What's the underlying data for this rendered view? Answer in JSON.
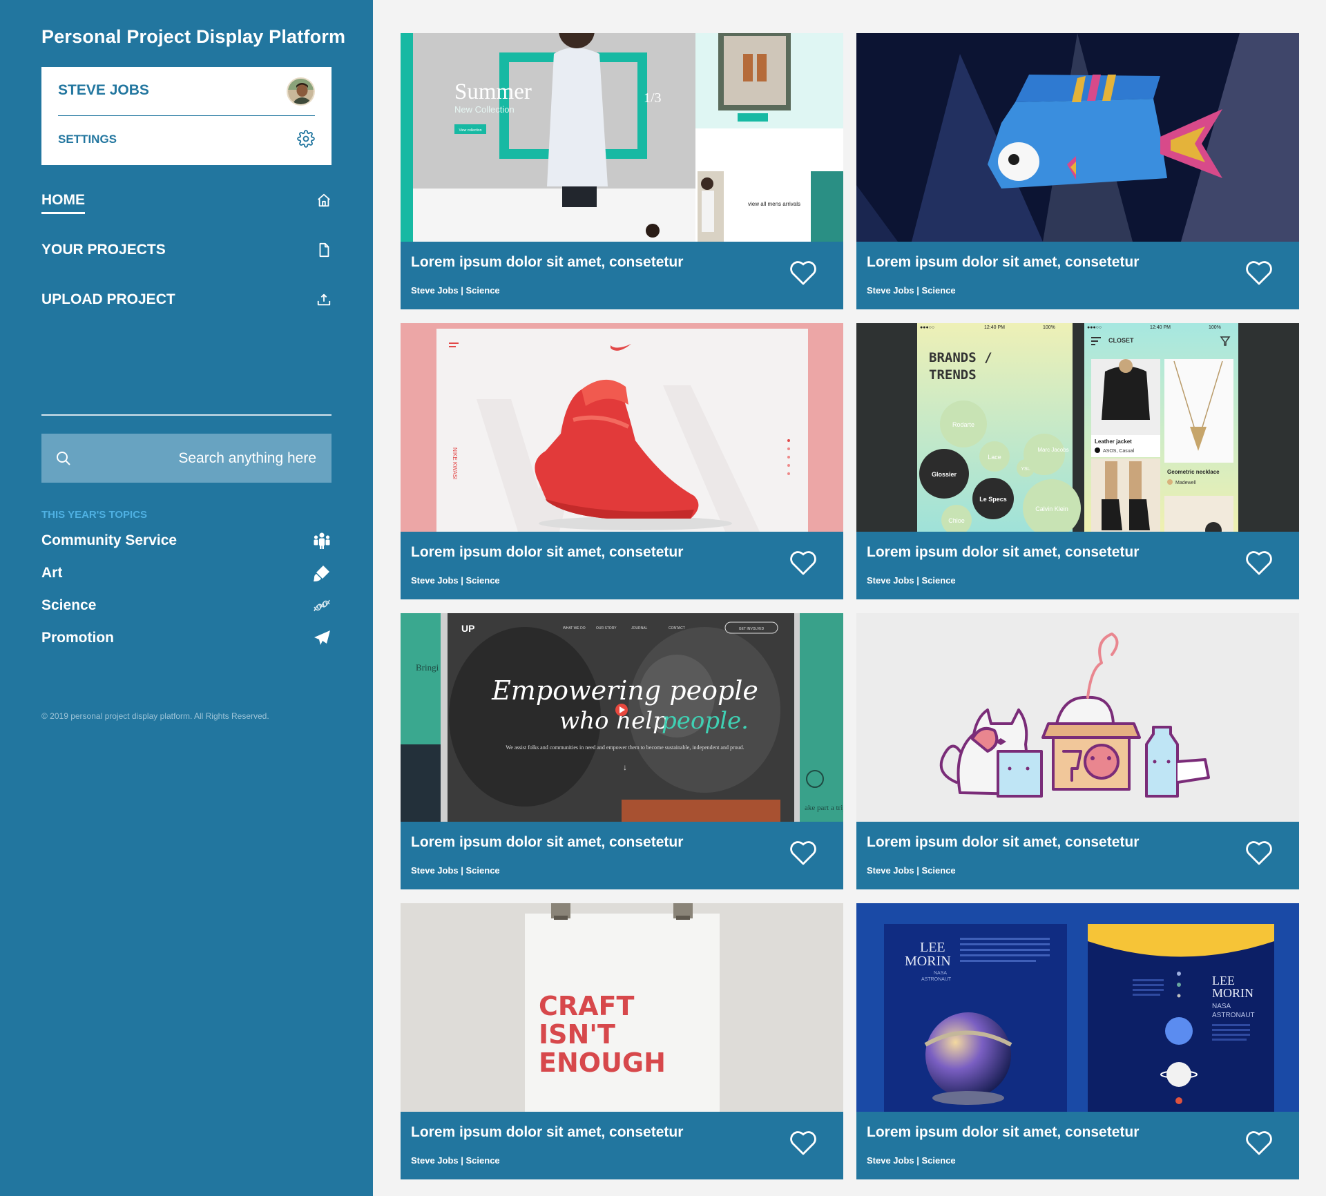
{
  "app": {
    "title": "Personal Project Display Platform"
  },
  "profile": {
    "name": "STEVE JOBS",
    "settings_label": "SETTINGS"
  },
  "nav": [
    {
      "label": "HOME",
      "icon": "home-icon",
      "active": true
    },
    {
      "label": "YOUR PROJECTS",
      "icon": "document-icon"
    },
    {
      "label": "UPLOAD PROJECT",
      "icon": "upload-icon"
    }
  ],
  "search": {
    "placeholder": "Search anything here"
  },
  "topics": {
    "heading": "THIS YEAR'S TOPICS",
    "items": [
      {
        "label": "Community Service",
        "icon": "people-icon"
      },
      {
        "label": "Art",
        "icon": "paint-brush-icon"
      },
      {
        "label": "Science",
        "icon": "dna-icon"
      },
      {
        "label": "Promotion",
        "icon": "paper-plane-icon"
      }
    ]
  },
  "footer": {
    "copyright": "© 2019 personal project display platform. All Rights Reserved."
  },
  "projects": [
    {
      "title": "Lorem ipsum dolor sit amet, consetetur",
      "author": "Steve Jobs",
      "category": "Science",
      "meta": "Steve Jobs | Science",
      "thumbnail": {
        "headline": "Summer",
        "subline": "New Collection",
        "button": "View collection",
        "counter": "1/3",
        "link": "view all mens arrivals"
      }
    },
    {
      "title": "Lorem ipsum dolor sit amet, consetetur",
      "author": "Steve Jobs",
      "category": "Science",
      "meta": "Steve Jobs | Science",
      "thumbnail": {}
    },
    {
      "title": "Lorem ipsum dolor sit amet, consetetur",
      "author": "Steve Jobs",
      "category": "Science",
      "meta": "Steve Jobs | Science",
      "thumbnail": {
        "side_text": "NIKE KWASI"
      }
    },
    {
      "title": "Lorem ipsum dolor sit amet, consetetur",
      "author": "Steve Jobs",
      "category": "Science",
      "meta": "Steve Jobs | Science",
      "thumbnail": {
        "time": "12:40 PM",
        "battery": "100%",
        "heading_1": "BRANDS /",
        "heading_2": "TRENDS",
        "brands": [
          "Rodarte",
          "Lace",
          "Marc Jacobs",
          "YSL",
          "Glossier",
          "Le Specs",
          "Calvin Klein",
          "Chloe"
        ],
        "closet_title": "CLOSET",
        "item_1": "Leather jacket",
        "item_1_sub": "ASOS, Casual",
        "item_2": "Geometric necklace",
        "item_2_sub": "Madewell"
      }
    },
    {
      "title": "Lorem ipsum dolor sit amet, consetetur",
      "author": "Steve Jobs",
      "category": "Science",
      "meta": "Steve Jobs | Science",
      "thumbnail": {
        "line_1": "Empowering people",
        "line_2": "who help",
        "line_3": "people.",
        "body": "We assist folks and communities in need and empower them to become sustainable, independent and proud.",
        "menu": [
          "WHAT WE DO",
          "OUR STORY",
          "JOURNAL",
          "CONTACT"
        ],
        "cta": "GET INVOLVED",
        "left_text": "Bringi to ou",
        "right_text": "ake part a trip."
      }
    },
    {
      "title": "Lorem ipsum dolor sit amet, consetetur",
      "author": "Steve Jobs",
      "category": "Science",
      "meta": "Steve Jobs | Science",
      "thumbnail": {}
    },
    {
      "title": "Lorem ipsum dolor sit amet, consetetur",
      "author": "Steve Jobs",
      "category": "Science",
      "meta": "Steve Jobs | Science",
      "thumbnail": {
        "line_1": "CRAFT",
        "line_2": "ISN'T",
        "line_3": "ENOUGH"
      }
    },
    {
      "title": "Lorem ipsum dolor sit amet, consetetur",
      "author": "Steve Jobs",
      "category": "Science",
      "meta": "Steve Jobs | Science",
      "thumbnail": {
        "name_1": "LEE",
        "name_2": "MORIN",
        "role_1": "NASA",
        "role_2": "ASTRONAUT"
      }
    }
  ]
}
